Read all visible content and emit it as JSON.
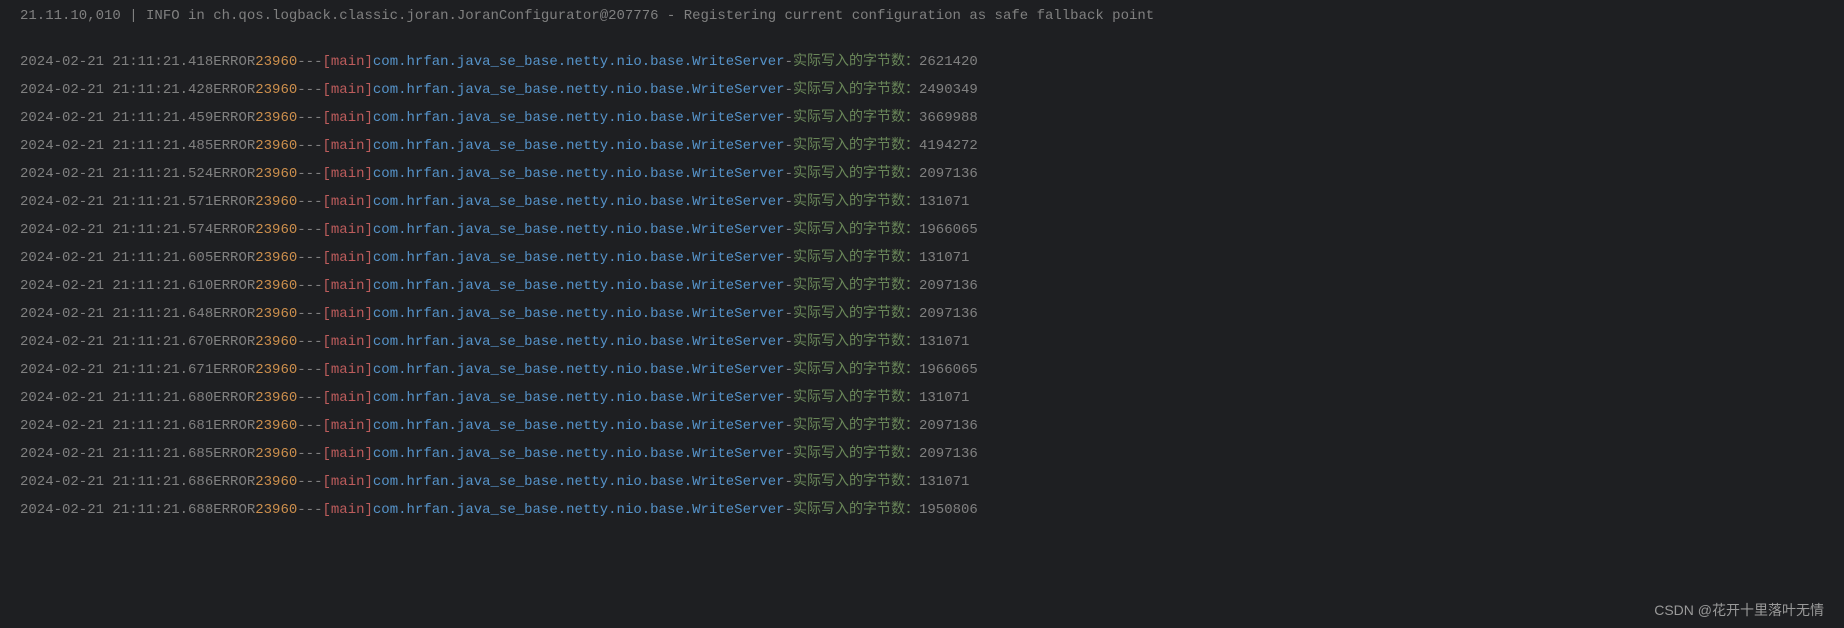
{
  "truncated_header": "21.11.10,010 | INFO in ch.qos.logback.classic.joran.JoranConfigurator@207776 - Registering current configuration as safe fallback point",
  "pid": "23960",
  "thread": "[main]",
  "logger": "com.hrfan.java_se_base.netty.nio.base.WriteServer",
  "message_label": "实际写入的字节数：",
  "level": "ERROR",
  "separator": "---",
  "dash": "-",
  "logs": [
    {
      "timestamp": "2024-02-21 21:11:21.418",
      "value": "2621420"
    },
    {
      "timestamp": "2024-02-21 21:11:21.428",
      "value": "2490349"
    },
    {
      "timestamp": "2024-02-21 21:11:21.459",
      "value": "3669988"
    },
    {
      "timestamp": "2024-02-21 21:11:21.485",
      "value": "4194272"
    },
    {
      "timestamp": "2024-02-21 21:11:21.524",
      "value": "2097136"
    },
    {
      "timestamp": "2024-02-21 21:11:21.571",
      "value": "131071"
    },
    {
      "timestamp": "2024-02-21 21:11:21.574",
      "value": "1966065"
    },
    {
      "timestamp": "2024-02-21 21:11:21.605",
      "value": "131071"
    },
    {
      "timestamp": "2024-02-21 21:11:21.610",
      "value": "2097136"
    },
    {
      "timestamp": "2024-02-21 21:11:21.648",
      "value": "2097136"
    },
    {
      "timestamp": "2024-02-21 21:11:21.670",
      "value": "131071"
    },
    {
      "timestamp": "2024-02-21 21:11:21.671",
      "value": "1966065"
    },
    {
      "timestamp": "2024-02-21 21:11:21.680",
      "value": "131071"
    },
    {
      "timestamp": "2024-02-21 21:11:21.681",
      "value": "2097136"
    },
    {
      "timestamp": "2024-02-21 21:11:21.685",
      "value": "2097136"
    },
    {
      "timestamp": "2024-02-21 21:11:21.686",
      "value": "131071"
    },
    {
      "timestamp": "2024-02-21 21:11:21.688",
      "value": "1950806"
    }
  ],
  "watermark": "CSDN @花开十里落叶无情"
}
